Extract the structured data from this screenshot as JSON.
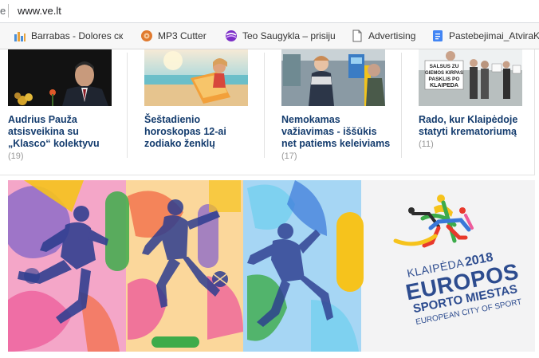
{
  "address_bar": {
    "cut_char": "e",
    "url": "www.ve.lt"
  },
  "bookmarks": [
    {
      "label": "Barrabas - Dolores ск",
      "icon": "equalizer-icon"
    },
    {
      "label": "MP3 Cutter",
      "icon": "mp3-cutter-icon"
    },
    {
      "label": "Teo Saugykla – prisiju",
      "icon": "teo-logo-icon"
    },
    {
      "label": "Advertising",
      "icon": "document-icon"
    },
    {
      "label": "Pastebejimai_AtvirаK",
      "icon": "google-docs-icon"
    }
  ],
  "news": [
    {
      "title": "Audrius Pauža atsisveikina su „Klasco“ kolektyvu",
      "count": "(19)"
    },
    {
      "title": "Šeštadienio horoskopas 12-ai zodiako ženklų",
      "count": ""
    },
    {
      "title": "Nemokamas važiavimas - iššūkis net patiems keleiviams",
      "count": "(17)"
    },
    {
      "title": "Rado, kur Klaipėdoje statyti krematoriumą",
      "count": "(11)"
    }
  ],
  "protest_sign": {
    "line1": "SALSUS ZU",
    "line2": "GIEMOS KIRPAS",
    "line3": "PASKLIS PO",
    "line4": "KLAIPEDA"
  },
  "banner": {
    "city": "KLAIPĖDA",
    "year": "2018",
    "title": "EUROPOS",
    "subtitle": "SPORTO MIESTAS",
    "english": "EUROPEAN CITY OF SPORT",
    "colors": {
      "brand_blue": "#2d4c8f",
      "pink": "#ee5b9a",
      "yellow": "#f6c31c",
      "green": "#3dab4a",
      "red": "#e8392c"
    }
  }
}
